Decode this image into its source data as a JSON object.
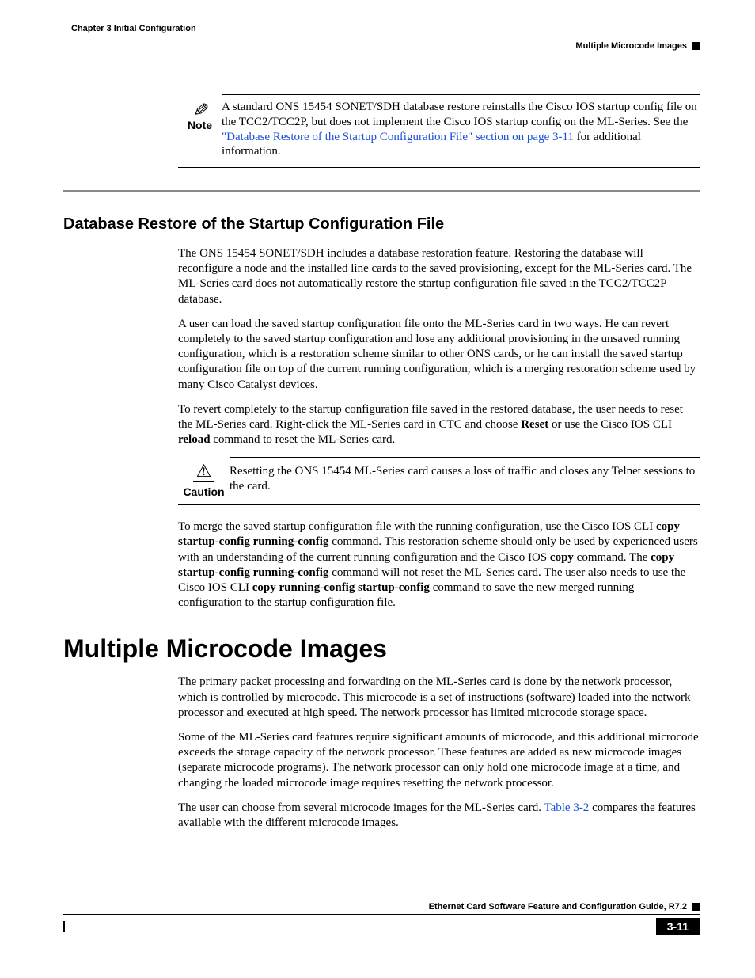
{
  "header": {
    "chapter": "Chapter 3    Initial Configuration",
    "section": "Multiple Microcode Images"
  },
  "note": {
    "label": "Note",
    "body_pre": "A standard ONS 15454 SONET/SDH database restore reinstalls the Cisco IOS startup config file on the TCC2/TCC2P, but does not implement the Cisco IOS startup config on the ML-Series. See the ",
    "link": "\"Database Restore of the Startup Configuration File\" section on page 3-11",
    "body_post": " for additional information."
  },
  "section1": {
    "heading": "Database Restore of the Startup Configuration File",
    "p1": "The ONS 15454 SONET/SDH includes a database restoration feature. Restoring the database will reconfigure a node and the installed line cards to the saved provisioning, except for the ML-Series card. The ML-Series card does not automatically restore the startup configuration file saved in the TCC2/TCC2P database.",
    "p2": "A user can load the saved startup configuration file onto the ML-Series card in two ways. He can revert completely to the saved startup configuration and lose any additional provisioning in the unsaved running configuration, which is a restoration scheme similar to other ONS cards, or he can install the saved startup configuration file on top of the current running configuration, which is a merging restoration scheme used by many Cisco Catalyst devices.",
    "p3_a": "To revert completely to the startup configuration file saved in the restored database, the user needs to reset the ML-Series card. Right-click the ML-Series card in CTC and choose ",
    "p3_b": "Reset",
    "p3_c": " or use the Cisco IOS CLI ",
    "p3_d": "reload",
    "p3_e": " command to reset the ML-Series card.",
    "caution_label": "Caution",
    "caution_body": "Resetting the ONS 15454 ML-Series card causes a loss of traffic and closes any Telnet sessions to the card.",
    "p4_a": "To merge the saved startup configuration file with the running configuration, use the Cisco IOS CLI ",
    "p4_b": "copy startup-config running-config",
    "p4_c": " command. This restoration scheme should only be used by experienced users with an understanding of the current running configuration and the Cisco IOS ",
    "p4_d": "copy",
    "p4_e": " command. The ",
    "p4_f": "copy startup-config running-config",
    "p4_g": " command will not reset the ML-Series card. The user also needs to use the Cisco IOS CLI ",
    "p4_h": "copy running-config startup-config",
    "p4_i": " command to save the new merged running configuration to the startup configuration file."
  },
  "section2": {
    "heading": "Multiple Microcode Images",
    "p1": "The primary packet processing and forwarding on the ML-Series card is done by the network processor, which is controlled by microcode. This microcode is a set of instructions (software) loaded into the network processor and executed at high speed. The network processor has limited microcode storage space.",
    "p2": "Some of the ML-Series card features require significant amounts of microcode, and this additional microcode exceeds the storage capacity of the network processor. These features are added as new microcode images (separate microcode programs). The network processor can only hold one microcode image at a time, and changing the loaded microcode image requires resetting the network processor.",
    "p3_a": "The user can choose from several microcode images for the ML-Series card. ",
    "p3_link": "Table 3-2",
    "p3_b": " compares the features available with the different microcode images."
  },
  "footer": {
    "title": "Ethernet Card Software Feature and Configuration Guide, R7.2",
    "pagenum": "3-11"
  }
}
